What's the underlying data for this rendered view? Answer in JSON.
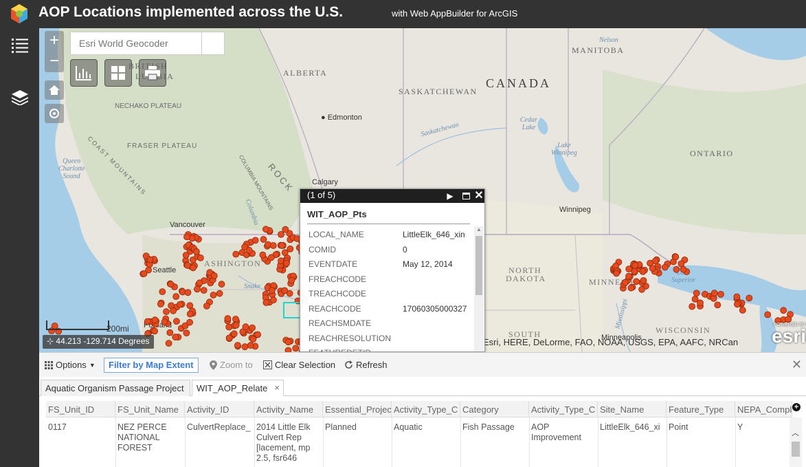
{
  "header": {
    "title": "AOP Locations implemented across the U.S.",
    "subtitle": "with Web AppBuilder for ArcGIS"
  },
  "colors": {
    "header_bg": "#333333",
    "accent": "#3a7bd5",
    "point": "#e8491d"
  },
  "map": {
    "search_placeholder": "Esri World Geocoder",
    "labels": {
      "canada": "CANADA",
      "manitoba": "MANITOBA",
      "alberta": "ALBERTA",
      "bc_a": "BRITISH",
      "bc_b": "LUMBIA",
      "saskatchewan": "SASKATCHEWAN",
      "ontario": "ONTARIO",
      "nechako": "NECHAKO PLATEAU",
      "fraser": "FRASER PLATEAU",
      "rocky": "ROCK",
      "columbia_mtns": "COLUMBIA MOUNTAINS",
      "coast_mtns": "COAST MOUNTAINS",
      "edmonton": "Edmonton",
      "calgary": "Calgary",
      "vancouver": "Vancouver",
      "seattle": "Seattle",
      "portland": "Portland",
      "winnipeg": "Winnipeg",
      "minneapolis": "Minneapolis",
      "washington": "ASHINGTON",
      "north": "NORTH",
      "dakota": "DAKOTA",
      "south": "SOUTH",
      "minnesota": "MINNESOTA",
      "wisconsin": "WISCONSIN",
      "queen_charlotte": "Queen\nCharlotte\nSound",
      "saskatchewan_river": "Saskatchewan",
      "cedar_lake": "Cedar\nLake",
      "lake_winnipeg": "Lake\nWinnipeg",
      "lake_superior": "Lake\nSuperior",
      "nelson": "Nelson",
      "snake": "Snake",
      "columbia_river": "Columbia",
      "mississippi": "Mississippi"
    },
    "scale_label": "200mi",
    "coordinates": "44.213 -129.714 Degrees",
    "attribution": "Esri, HERE, DeLorme, FAO, NOAA, USGS, EPA, AAFC, NRCan",
    "esri_powered": "POWERED BY",
    "esri_logo": "esri"
  },
  "popup": {
    "counter": "(1 of 5)",
    "layer_title": "WIT_AOP_Pts",
    "fields": [
      {
        "key": "LOCAL_NAME",
        "value": "LittleElk_646_xin"
      },
      {
        "key": "COMID",
        "value": "0"
      },
      {
        "key": "EVENTDATE",
        "value": "May 12, 2014"
      },
      {
        "key": "FREACHCODE",
        "value": ""
      },
      {
        "key": "TREACHCODE",
        "value": ""
      },
      {
        "key": "REACHCODE",
        "value": "17060305000327"
      },
      {
        "key": "REACHSMDATE",
        "value": ""
      },
      {
        "key": "REACHRESOLUTION",
        "value": ""
      },
      {
        "key": "FEATUREDETID",
        "value": ""
      }
    ]
  },
  "table_toolbar": {
    "options": "Options",
    "filter": "Filter by Map Extent",
    "zoom_to": "Zoom to",
    "clear_selection": "Clear Selection",
    "refresh": "Refresh"
  },
  "tabs": [
    {
      "label": "Aquatic Organism Passage Project"
    },
    {
      "label": "WIT_AOP_Relate"
    }
  ],
  "grid": {
    "columns": [
      "FS_Unit_ID",
      "FS_Unit_Name",
      "Activity_ID",
      "Activity_Name",
      "Essential_Project",
      "Activity_Type_C",
      "Category",
      "Activity_Type_C",
      "Site_Name",
      "Feature_Type",
      "NEPA_Compl"
    ],
    "row": [
      "0117",
      "NEZ PERCE NATIONAL FOREST",
      "CulvertReplace_",
      "2014 Little Elk Culvert Rep [lacement, mp 2.5, fsr646",
      "Planned",
      "Aquatic",
      "Fish Passage",
      "AOP Improvement",
      "LittleElk_646_xi",
      "Point",
      "Y"
    ]
  }
}
